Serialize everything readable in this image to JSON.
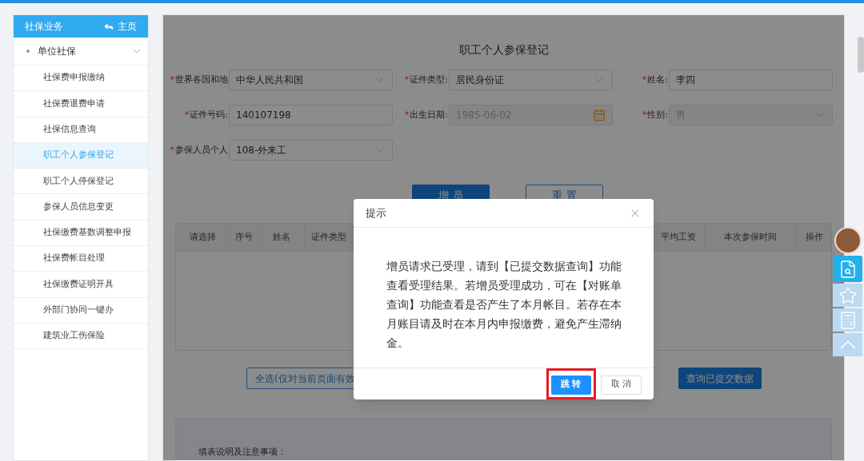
{
  "sidebar": {
    "title": "社保业务",
    "home_link": "主页",
    "group": {
      "label": "单位社保",
      "expanded": true,
      "items": [
        {
          "label": "社保费申报缴纳",
          "selected": false
        },
        {
          "label": "社保费退费申请",
          "selected": false
        },
        {
          "label": "社保信息查询",
          "selected": false
        },
        {
          "label": "职工个人参保登记",
          "selected": true
        },
        {
          "label": "职工个人停保登记",
          "selected": false
        },
        {
          "label": "参保人员信息变更",
          "selected": false
        },
        {
          "label": "社保缴费基数调整申报",
          "selected": false
        },
        {
          "label": "社保费帐目处理",
          "selected": false
        },
        {
          "label": "社保缴费证明开具",
          "selected": false
        },
        {
          "label": "外部门协同一键办",
          "selected": false
        },
        {
          "label": "建筑业工伤保险",
          "selected": false
        }
      ]
    }
  },
  "form": {
    "title": "职工个人参保登记",
    "fields": [
      {
        "mark": "*",
        "label": "世界各国和地",
        "kind": "select",
        "value": "中华人民共和国",
        "disabled": false
      },
      {
        "mark": "*",
        "label": "证件类型:",
        "kind": "select",
        "value": "居民身份证",
        "disabled": false
      },
      {
        "mark": "*",
        "label": "姓名:",
        "kind": "text",
        "value": "李四",
        "disabled": false
      },
      {
        "mark": "*",
        "label": "证件号码:",
        "kind": "text",
        "value": "140107198",
        "disabled": false
      },
      {
        "mark": "*",
        "label": "出生日期:",
        "kind": "date",
        "value": "1985-06-02",
        "disabled": true
      },
      {
        "mark": "*",
        "label": "性别:",
        "kind": "select",
        "value": "男",
        "disabled": true
      },
      {
        "mark": "*",
        "label": "参保人员个人",
        "kind": "select",
        "value": "108-外来工",
        "disabled": false
      }
    ],
    "buttons": [
      {
        "label": "增 员",
        "kind": "primary"
      },
      {
        "label": "重 置",
        "kind": "outline"
      }
    ]
  },
  "table": {
    "columns": [
      "请选择",
      "序号",
      "姓名",
      "证件类型",
      "",
      "平均工资",
      "本次参保时间",
      "操作"
    ]
  },
  "actions": [
    {
      "label": "全选(仅对当前页面有效",
      "kind": "outline"
    },
    {
      "label": "查询已提交数据",
      "kind": "primary"
    }
  ],
  "notes": {
    "title": "填表说明及注意事项："
  },
  "dialog": {
    "title": "提示",
    "message": "增员请求已受理，请到【已提交数据查询】功能查看受理结果。若增员受理成功，可在【对账单查询】功能查看是否产生了本月帐目。若存在本月账目请及时在本月内申报缴费，避免产生滞纳金。",
    "buttons": [
      {
        "label": "跳 转",
        "kind": "primary",
        "highlighted": true
      },
      {
        "label": "取 消",
        "kind": "default",
        "highlighted": false
      }
    ]
  },
  "side_tools": [
    {
      "kind": "search",
      "selected": true
    },
    {
      "kind": "star",
      "selected": false
    },
    {
      "kind": "calculator",
      "selected": false
    },
    {
      "kind": "up",
      "selected": false
    }
  ]
}
